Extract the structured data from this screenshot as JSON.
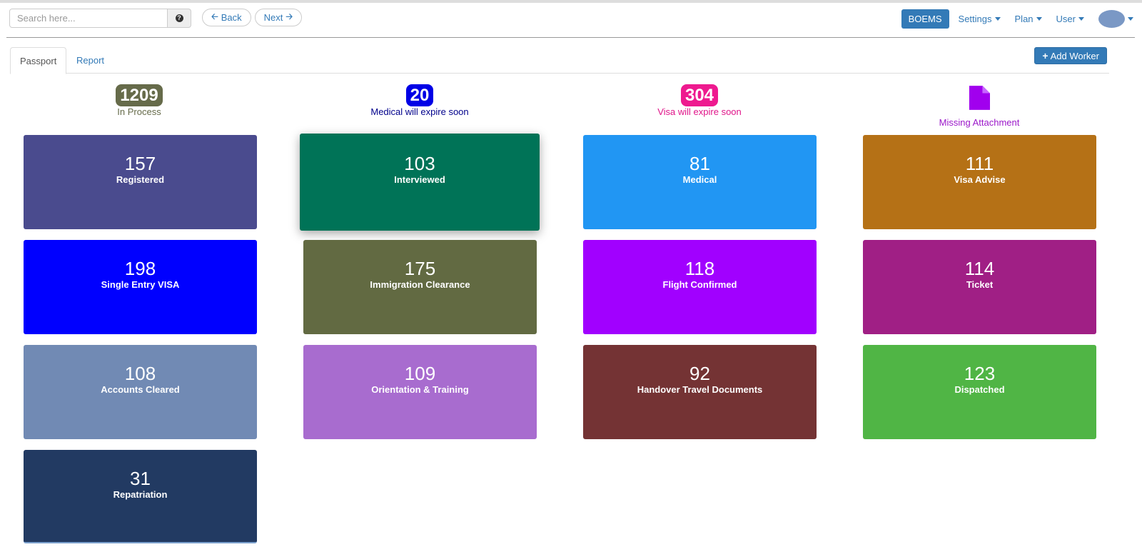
{
  "search": {
    "placeholder": "Search here..."
  },
  "nav": {
    "back": "Back",
    "next": "Next"
  },
  "menu": {
    "brand": "BOEMS",
    "settings": "Settings",
    "plan": "Plan",
    "user": "User"
  },
  "tabs": [
    {
      "label": "Passport"
    },
    {
      "label": "Report"
    }
  ],
  "add_worker_label": "Add Worker",
  "summary": {
    "in_process": {
      "count": "1209",
      "label": "In Process",
      "color": "#666b4a"
    },
    "medical_expire": {
      "count": "20",
      "label": "Medical will expire soon",
      "color": "#0000e6",
      "text_color": "#00008b"
    },
    "visa_expire": {
      "count": "304",
      "label": "Visa will expire soon",
      "color": "#ee1a8f",
      "text_color": "#e0168a"
    },
    "missing_attachment": {
      "label": "Missing Attachment",
      "color": "#a100ee",
      "text_color": "#9b17c9"
    }
  },
  "tiles": [
    {
      "count": "157",
      "label": "Registered",
      "color": "#4a4b8e"
    },
    {
      "count": "103",
      "label": "Interviewed",
      "color": "#007357"
    },
    {
      "count": "81",
      "label": "Medical",
      "color": "#2196f3"
    },
    {
      "count": "111",
      "label": "Visa Advise",
      "color": "#b57116"
    },
    {
      "count": "198",
      "label": "Single Entry VISA",
      "color": "#0000ff"
    },
    {
      "count": "175",
      "label": "Immigration Clearance",
      "color": "#626a42"
    },
    {
      "count": "118",
      "label": "Flight Confirmed",
      "color": "#a100ff"
    },
    {
      "count": "114",
      "label": "Ticket",
      "color": "#a01f85"
    },
    {
      "count": "108",
      "label": "Accounts Cleared",
      "color": "#718ab4"
    },
    {
      "count": "109",
      "label": "Orientation & Training",
      "color": "#a86ccf"
    },
    {
      "count": "92",
      "label": "Handover Travel Documents",
      "color": "#743334"
    },
    {
      "count": "123",
      "label": "Dispatched",
      "color": "#50b545"
    },
    {
      "count": "31",
      "label": "Repatriation",
      "color": "#223a62"
    }
  ]
}
